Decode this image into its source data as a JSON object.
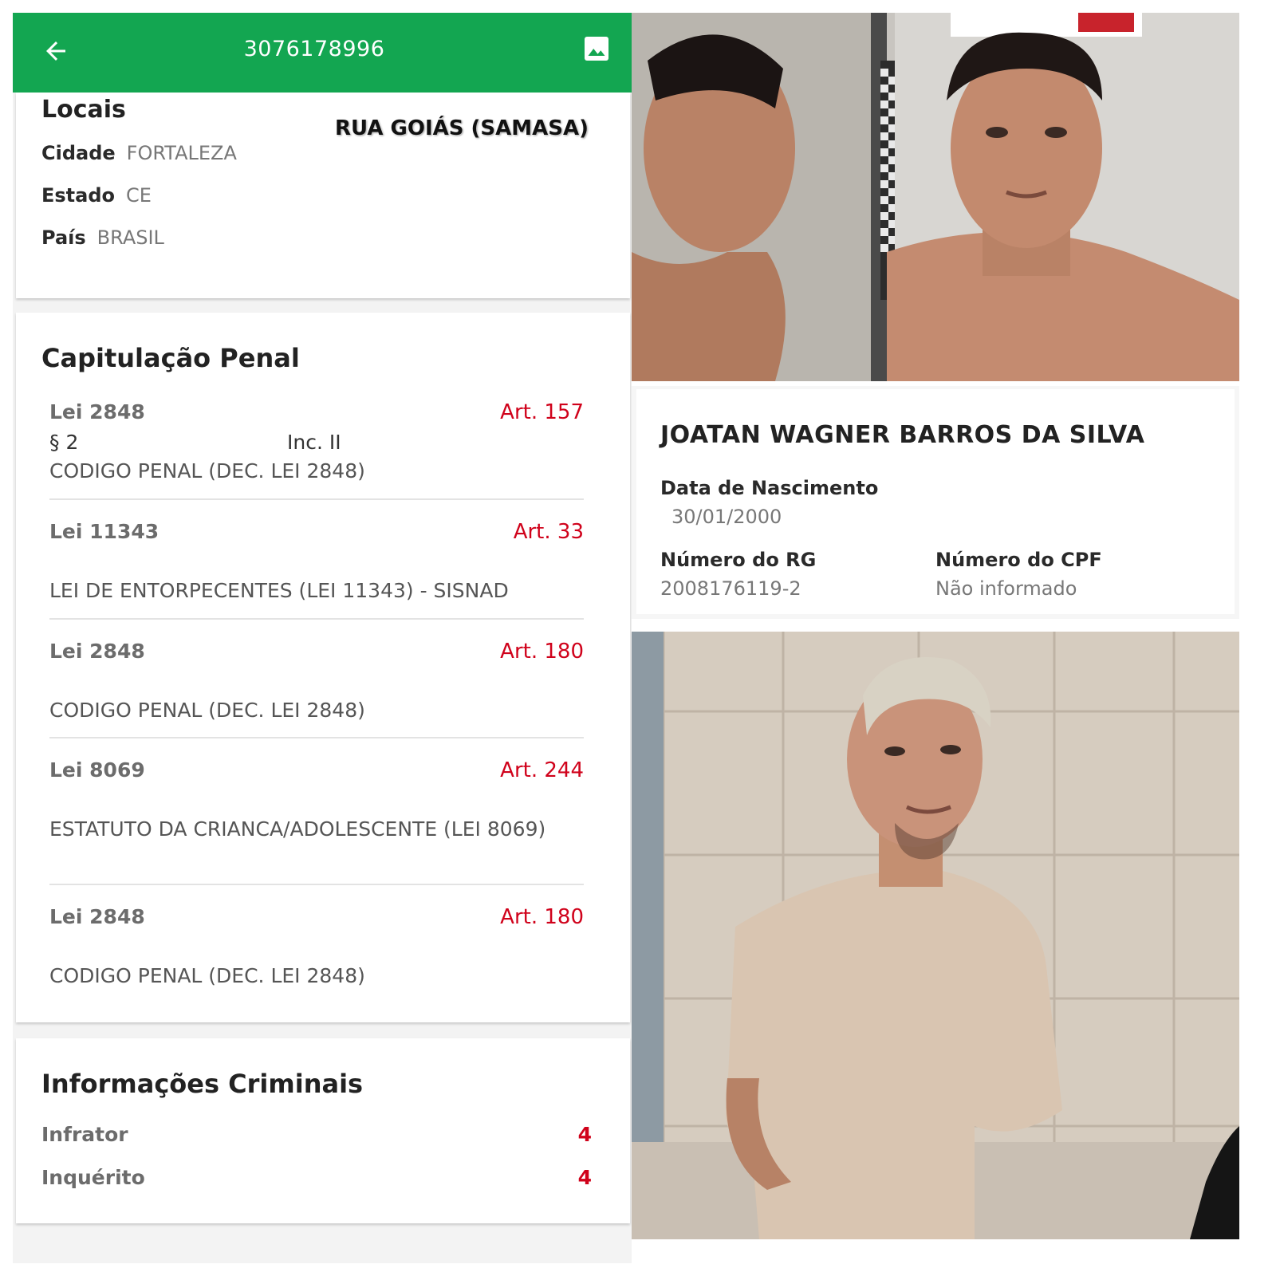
{
  "appbar": {
    "title": "3076178996"
  },
  "locais": {
    "heading": "Locais",
    "street": "RUA GOIÁS (SAMASA)",
    "city_label": "Cidade",
    "city": "FORTALEZA",
    "state_label": "Estado",
    "state": "CE",
    "country_label": "País",
    "country": "BRASIL"
  },
  "capitulacao": {
    "heading": "Capitulação Penal",
    "items": [
      {
        "lei": "Lei 2848",
        "art": "Art. 157",
        "paragrafo": "§ 2",
        "inciso": "Inc. II",
        "desc": "CODIGO PENAL (DEC. LEI 2848)"
      },
      {
        "lei": "Lei 11343",
        "art": "Art. 33",
        "desc": "LEI DE ENTORPECENTES (LEI 11343) - SISNAD"
      },
      {
        "lei": "Lei 2848",
        "art": "Art. 180",
        "desc": "CODIGO PENAL (DEC. LEI 2848)"
      },
      {
        "lei": "Lei 8069",
        "art": "Art. 244",
        "desc": "ESTATUTO DA CRIANCA/ADOLESCENTE (LEI 8069)"
      },
      {
        "lei": "Lei 2848",
        "art": "Art. 180",
        "desc": "CODIGO PENAL (DEC. LEI 2848)"
      }
    ]
  },
  "criminais": {
    "heading": "Informações Criminais",
    "infrator_label": "Infrator",
    "infrator": "4",
    "inquerito_label": "Inquérito",
    "inquerito": "4"
  },
  "person": {
    "name": "JOATAN WAGNER BARROS DA SILVA",
    "dob_label": "Data de Nascimento",
    "dob": "30/01/2000",
    "rg_label": "Número do RG",
    "rg": "2008176119-2",
    "cpf_label": "Número do CPF",
    "cpf": "Não informado"
  },
  "colors": {
    "appbar": "#13a651",
    "accent_red": "#d0021b"
  }
}
